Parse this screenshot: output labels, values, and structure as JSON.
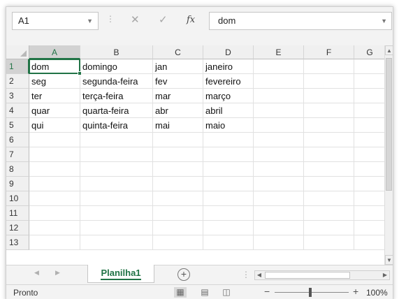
{
  "formula_bar": {
    "name_box": "A1",
    "cancel_icon": "close-icon",
    "enter_icon": "check-icon",
    "fx_label": "fx",
    "content": "dom"
  },
  "columns": [
    "A",
    "B",
    "C",
    "D",
    "E",
    "F",
    "G"
  ],
  "rows": [
    "1",
    "2",
    "3",
    "4",
    "5",
    "6",
    "7",
    "8",
    "9",
    "10",
    "11",
    "12",
    "13"
  ],
  "cells": [
    [
      "dom",
      "domingo",
      "jan",
      "janeiro"
    ],
    [
      "seg",
      "segunda-feira",
      "fev",
      "fevereiro"
    ],
    [
      "ter",
      "terça-feira",
      "mar",
      "março"
    ],
    [
      "quar",
      "quarta-feira",
      "abr",
      "abril"
    ],
    [
      "qui",
      "quinta-feira",
      "mai",
      "maio"
    ]
  ],
  "selected_cell": "A1",
  "sheet_tabs": {
    "active": "Planilha1",
    "add_label": "+"
  },
  "status": {
    "ready": "Pronto",
    "zoom_minus": "−",
    "zoom_plus": "+",
    "zoom": "100%"
  },
  "colors": {
    "accent": "#217346",
    "header_bg": "#f0f0f0",
    "grid_line": "#e1e1e1"
  }
}
